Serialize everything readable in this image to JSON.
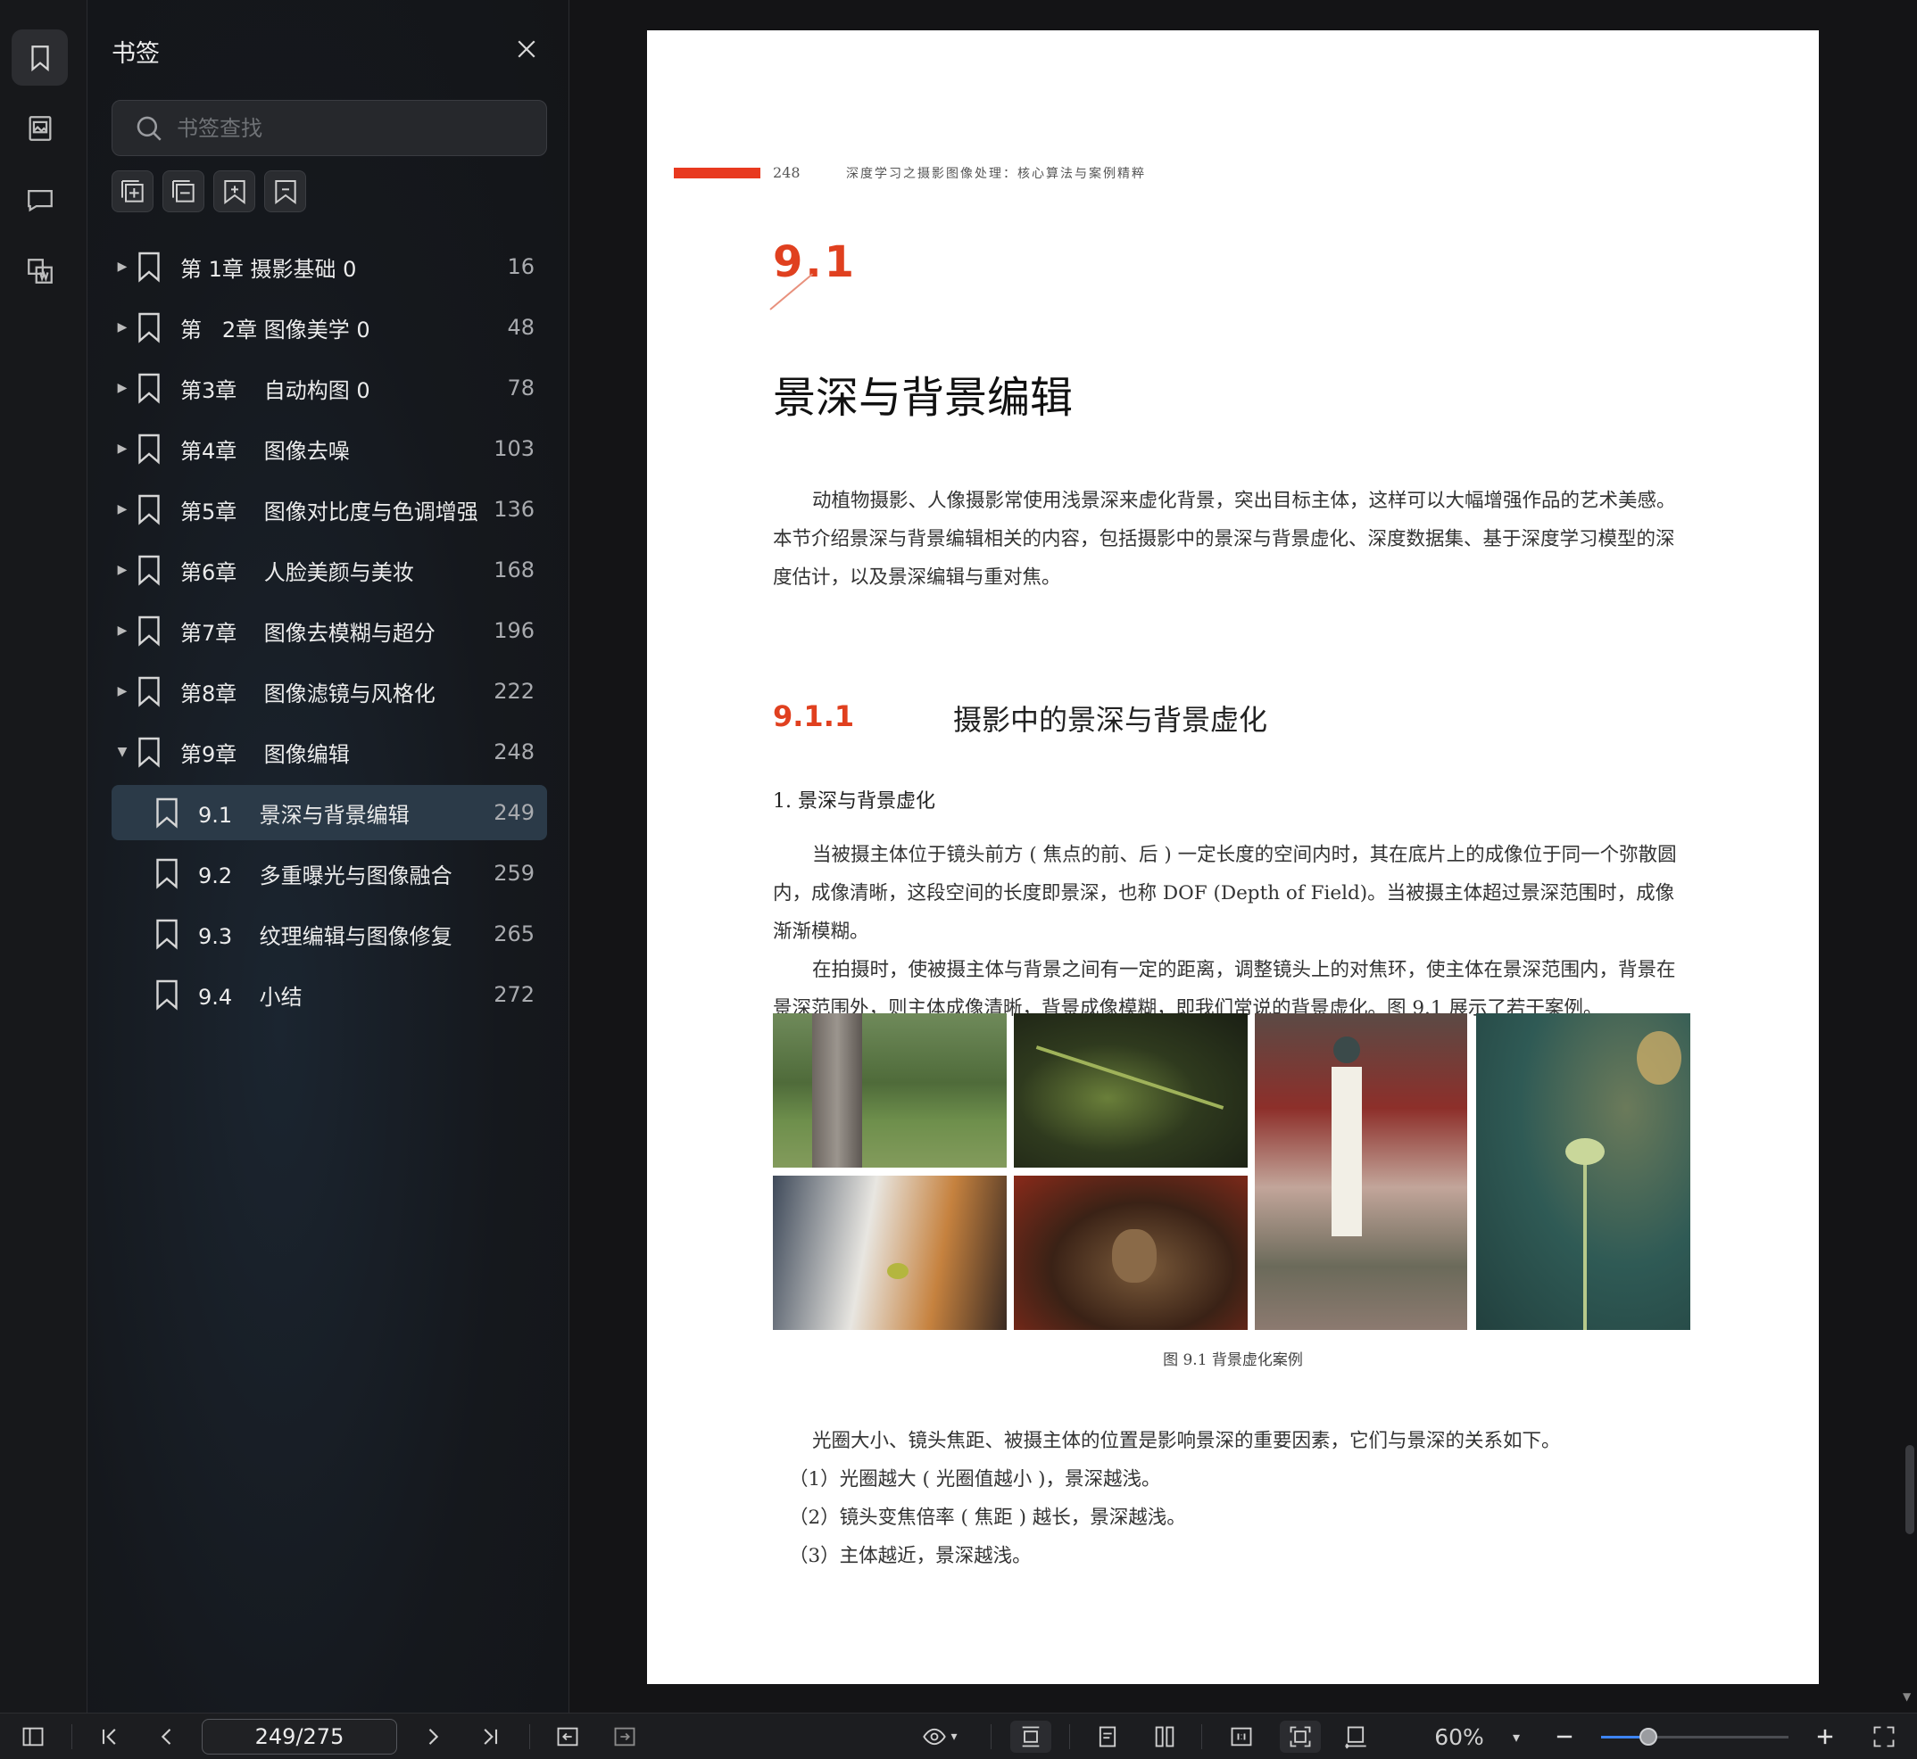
{
  "panel": {
    "title": "书签",
    "search_placeholder": "书签查找"
  },
  "bookmarks": [
    {
      "label": "第 1章 摄影基础 0",
      "page": "16",
      "expanded": false,
      "child": false
    },
    {
      "label": "第   2章 图像美学 0",
      "page": "48",
      "expanded": false,
      "child": false
    },
    {
      "label": "第3章    自动构图 0",
      "page": "78",
      "expanded": false,
      "child": false
    },
    {
      "label": "第4章    图像去噪",
      "page": "103",
      "expanded": false,
      "child": false
    },
    {
      "label": "第5章    图像对比度与色调增强",
      "page": "136",
      "expanded": false,
      "child": false
    },
    {
      "label": "第6章    人脸美颜与美妆",
      "page": "168",
      "expanded": false,
      "child": false
    },
    {
      "label": "第7章    图像去模糊与超分",
      "page": "196",
      "expanded": false,
      "child": false
    },
    {
      "label": "第8章    图像滤镜与风格化",
      "page": "222",
      "expanded": false,
      "child": false
    },
    {
      "label": "第9章    图像编辑",
      "page": "248",
      "expanded": true,
      "child": false
    },
    {
      "label": "9.1    景深与背景编辑",
      "page": "249",
      "child": true,
      "active": true
    },
    {
      "label": "9.2    多重曝光与图像融合",
      "page": "259",
      "child": true
    },
    {
      "label": "9.3    纹理编辑与图像修复",
      "page": "265",
      "child": true
    },
    {
      "label": "9.4    小结",
      "page": "272",
      "child": true
    }
  ],
  "page": {
    "running_page_number": "248",
    "running_title": "深度学习之摄影图像处理：核心算法与案例精粹",
    "section_number": "9.1",
    "section_title": "景深与背景编辑",
    "intro": "动植物摄影、人像摄影常使用浅景深来虚化背景，突出目标主体，这样可以大幅增强作品的艺术美感。本节介绍景深与背景编辑相关的内容，包括摄影中的景深与背景虚化、深度数据集、基于深度学习模型的深度估计，以及景深编辑与重对焦。",
    "subsection_number": "9.1.1",
    "subsection_title": "摄影中的景深与背景虚化",
    "heading4": "1. 景深与背景虚化",
    "para1": "当被摄主体位于镜头前方 ( 焦点的前、后 ) 一定长度的空间内时，其在底片上的成像位于同一个弥散圆内，成像清晰，这段空间的长度即景深，也称 DOF (Depth of Field)。当被摄主体超过景深范围时，成像渐渐模糊。",
    "para2": "在拍摄时，使被摄主体与背景之间有一定的距离，调整镜头上的对焦环，使主体在景深范围内，背景在景深范围外，则主体成像清晰，背景成像模糊，即我们常说的背景虚化。图 9.1 展示了若干案例。",
    "figure_caption": "图 9.1  背景虚化案例",
    "para3": "光圈大小、镜头焦距、被摄主体的位置是影响景深的重要因素，它们与景深的关系如下。",
    "list": [
      "（1）光圈越大 ( 光圈值越小 )，景深越浅。",
      "（2）镜头变焦倍率 ( 焦距 ) 越长，景深越浅。",
      "（3）主体越近，景深越浅。"
    ]
  },
  "toolbar": {
    "page_indicator": "249/275",
    "zoom": "60%",
    "zoom_fraction": 0.25
  },
  "colors": {
    "accent_red": "#e0401f",
    "active_row": "#2b3a48",
    "slider_blue": "#3d84f2"
  }
}
